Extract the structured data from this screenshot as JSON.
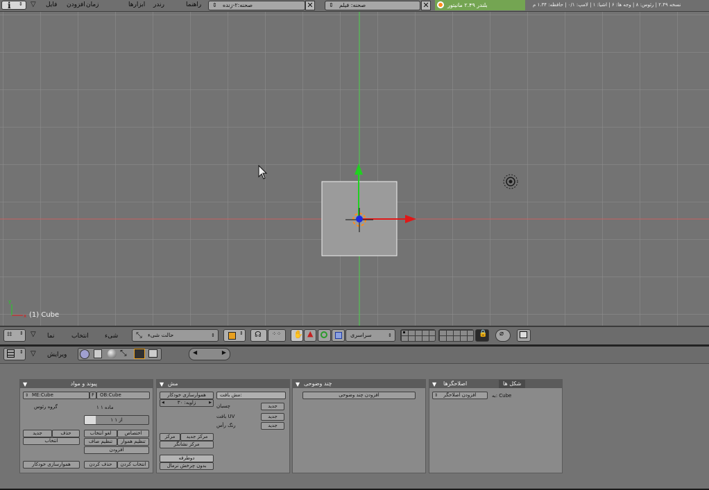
{
  "top_header": {
    "menus": [
      "فایل",
      "افزودن",
      "زمان",
      "ابزارها",
      "رندر",
      "راهنما"
    ],
    "screen_field": "صحنه:۲-زنده",
    "scene_field": "صحنه: فیلم",
    "render_info": "بلندر ۲.۴۹ مانیتور",
    "stats": "نسخه ۲.۴۹ | رئوس: ۸ | وجه ها: ۶ | اشیا: ۱ | لامپ: ۰/۱ | حافظه: ۱.۳۴ م"
  },
  "viewport": {
    "object_label": "(1) Cube"
  },
  "view3d_header": {
    "menus": [
      "نما",
      "انتخاب",
      "شیء"
    ],
    "mode_select": "حالت شیء",
    "pivot_select": "سراسری"
  },
  "buttons_header": {
    "label": "ویرایش"
  },
  "panels": {
    "link_materials": {
      "title": "پیوند و مواد",
      "me_field": "ME:Cube",
      "f_button": "F",
      "ob_field": "OB:Cube",
      "vertex_groups_label": "گروه رئوس",
      "material_label": "۱ ماده ۱",
      "material_counter": "۱ از ۱",
      "buttons": [
        "جدید",
        "حذف",
        "انتخاب",
        "لغو انتخاب",
        "اختصاص",
        "تنظیم صاف",
        "تنظیم هموار",
        "افزودن",
        "حذف کردن",
        "انتخاب کردن"
      ],
      "auto_smooth": "هموارسازی خودکار"
    },
    "mesh": {
      "title": "مش",
      "auto_smooth_btn": "هموارسازی خودکار",
      "degr_field": "زاویه: ۳۰",
      "tex_mesh": "مش بافت:",
      "sticky": "چسبان",
      "uv_texture": "بافت UV",
      "vertex_color": "رنگ رأس",
      "new1": "جدید",
      "new2": "جدید",
      "new3": "جدید",
      "center": "مرکز",
      "center_new": "مرکز جدید",
      "center_cursor": "مرکز نشانگر",
      "double_sided": "دوطرفه",
      "no_v_normal_flip": "بدون چرخش نرمال"
    },
    "multires": {
      "title": "چند وضوحی",
      "add_multires": "افزودن چند وضوحی"
    },
    "modifiers": {
      "tab_modifiers": "اصلاحگرها",
      "tab_shapes": "شکل ها",
      "add_modifier": "افزودن اصلاحگر",
      "to": "به: Cube"
    }
  }
}
